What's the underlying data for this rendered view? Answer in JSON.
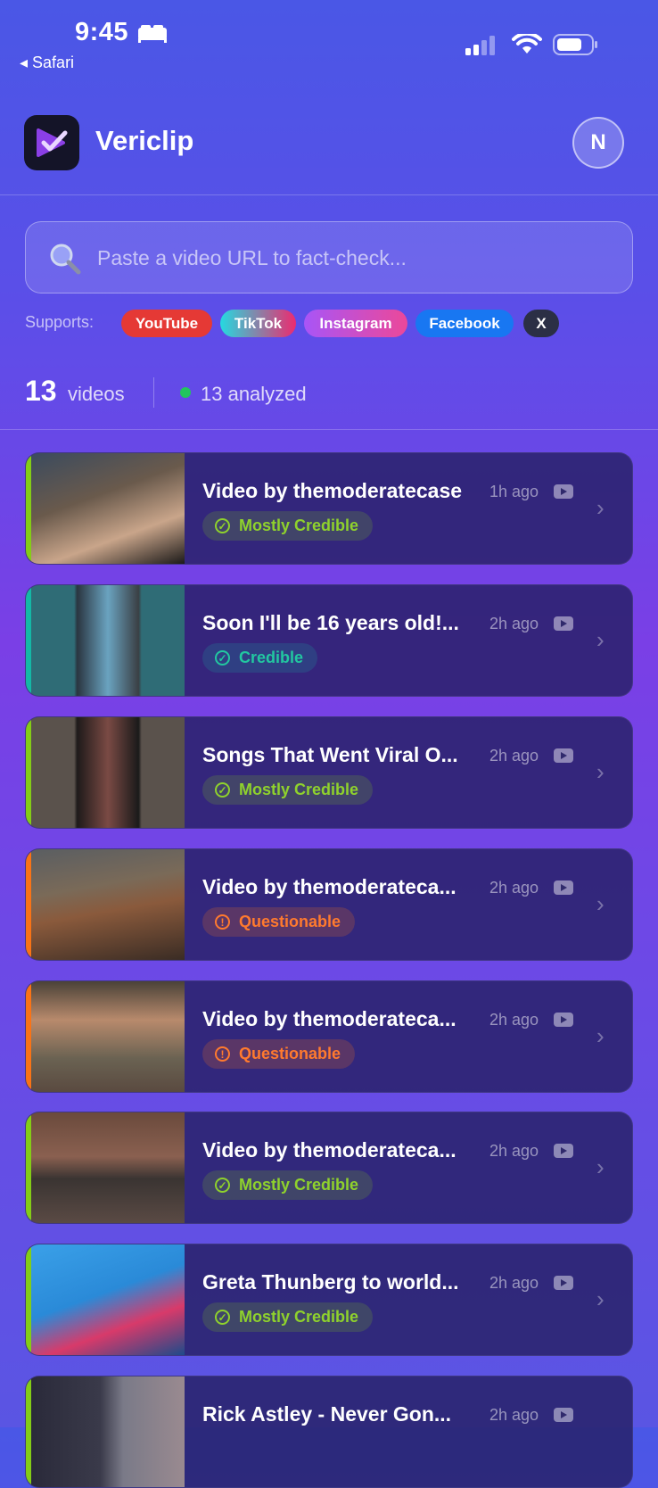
{
  "status_bar": {
    "time": "9:45",
    "back_label": "◂ Safari"
  },
  "header": {
    "app_name": "Vericlip",
    "avatar_initial": "N"
  },
  "search": {
    "placeholder": "Paste a video URL to fact-check..."
  },
  "supports": {
    "label": "Supports:",
    "platforms": [
      "YouTube",
      "TikTok",
      "Instagram",
      "Facebook",
      "X"
    ]
  },
  "stats": {
    "video_count": "13",
    "video_label": "videos",
    "analyzed_label": "13 analyzed"
  },
  "videos": [
    {
      "title": "Video by themoderatecase",
      "time": "1h ago",
      "status": "Mostly Credible"
    },
    {
      "title": "Soon I'll be 16 years old!...",
      "time": "2h ago",
      "status": "Credible"
    },
    {
      "title": "Songs That Went Viral O...",
      "time": "2h ago",
      "status": "Mostly Credible"
    },
    {
      "title": "Video by themoderateca...",
      "time": "2h ago",
      "status": "Questionable"
    },
    {
      "title": "Video by themoderateca...",
      "time": "2h ago",
      "status": "Questionable"
    },
    {
      "title": "Video by themoderateca...",
      "time": "2h ago",
      "status": "Mostly Credible"
    },
    {
      "title": "Greta Thunberg to world...",
      "time": "2h ago",
      "status": "Mostly Credible"
    },
    {
      "title": "Rick Astley - Never Gon...",
      "time": "2h ago",
      "status": ""
    }
  ],
  "colors": {
    "mostly_credible": "#8fd22c",
    "credible": "#22c8a0",
    "questionable": "#ff7a2e",
    "youtube": "#e53935",
    "instagram": "#d946ef",
    "facebook": "#1877f2"
  }
}
